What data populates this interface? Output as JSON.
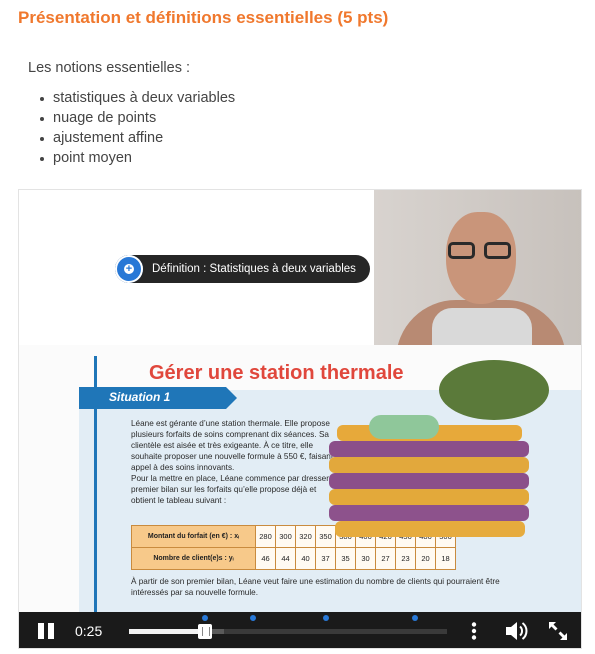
{
  "section": {
    "title": "Présentation et définitions essentielles (5 pts)",
    "intro": "Les notions essentielles :",
    "notions": [
      "statistiques à deux variables",
      "nuage de points",
      "ajustement affine",
      "point moyen"
    ]
  },
  "video": {
    "tooltip": "Définition : Statistiques à deux variables",
    "current_time": "0:25",
    "progress": 0.24,
    "markers": [
      0.24,
      0.39,
      0.62,
      0.9
    ],
    "colors": {
      "accent": "#2878d6",
      "controls_bg": "#1a1a1a"
    }
  },
  "slide": {
    "title": "Gérer une station thermale",
    "situation": "Situation 1",
    "body": "Léane est gérante d’une station thermale. Elle propose plusieurs forfaits de soins comprenant dix séances. Sa clientèle est aisée et très exigeante. À ce titre, elle souhaite proposer une nouvelle formule à 550 €, faisant appel à des soins innovants.\nPour la mettre en place, Léane commence par dresser un premier bilan sur les forfaits qu’elle propose déjà et obtient le tableau suivant :",
    "table": {
      "row1_label": "Montant du forfait (en €) : xᵢ",
      "row1_values": [
        "280",
        "300",
        "320",
        "350",
        "380",
        "400",
        "420",
        "450",
        "480",
        "500"
      ],
      "row2_label": "Nombre de client(e)s : yᵢ",
      "row2_values": [
        "46",
        "44",
        "40",
        "37",
        "35",
        "30",
        "27",
        "23",
        "20",
        "18"
      ]
    },
    "footer": "À partir de son premier bilan, Léane veut faire une estimation du nombre de clients qui pourraient être intéressés par sa nouvelle formule."
  }
}
